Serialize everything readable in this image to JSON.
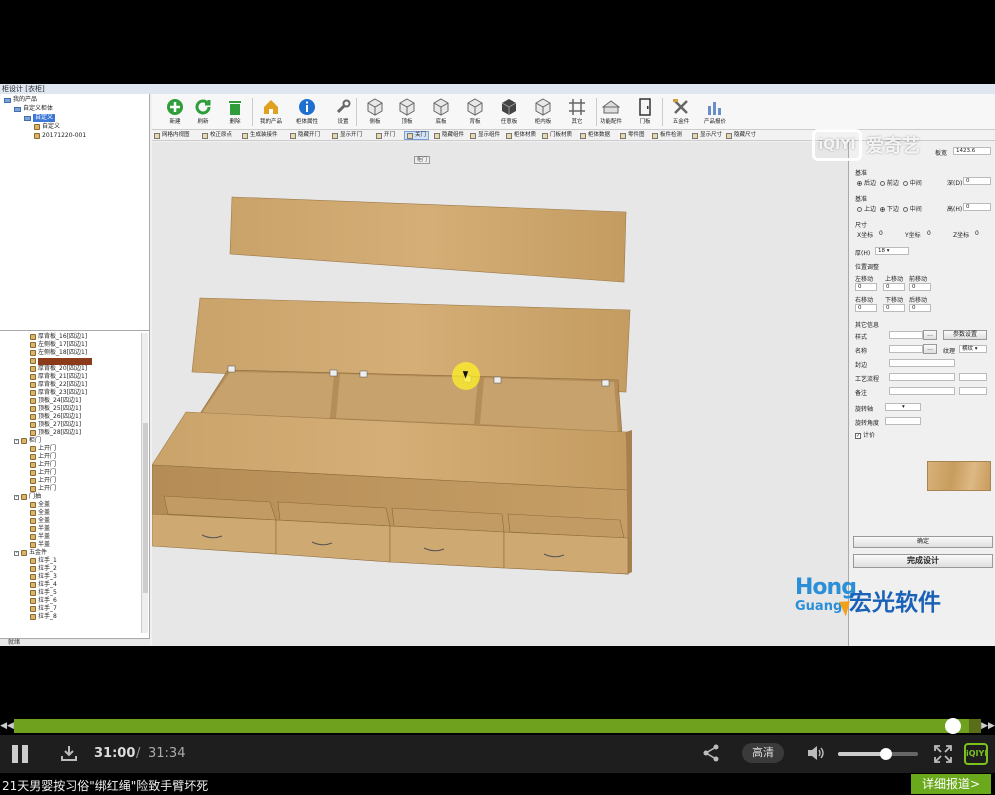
{
  "app": {
    "title": "柜设计 [衣柜]",
    "tree_top": [
      {
        "label": "我的产品",
        "level": 0,
        "kind": "folder"
      },
      {
        "label": "自定义柜体",
        "level": 1,
        "kind": "folder"
      },
      {
        "label": "自定义",
        "level": 2,
        "kind": "folder",
        "selected": true
      },
      {
        "label": "自定义",
        "level": 3,
        "kind": "item"
      },
      {
        "label": "20171220-001",
        "level": 3,
        "kind": "item"
      }
    ],
    "tree_bottom": [
      {
        "label": "厚背板_16[四边1]",
        "level": 3
      },
      {
        "label": "左侧板_17[四边1]",
        "level": 3
      },
      {
        "label": "左侧板_18[四边1]",
        "level": 3
      },
      {
        "label": "",
        "level": 3,
        "selected_red": true
      },
      {
        "label": "厚背板_20[四边1]",
        "level": 3
      },
      {
        "label": "厚背板_21[四边1]",
        "level": 3
      },
      {
        "label": "厚背板_22[四边1]",
        "level": 3
      },
      {
        "label": "厚背板_23[四边1]",
        "level": 3
      },
      {
        "label": "顶板_24[四边1]",
        "level": 3
      },
      {
        "label": "顶板_25[四边1]",
        "level": 3
      },
      {
        "label": "顶板_26[四边1]",
        "level": 3
      },
      {
        "label": "顶板_27[四边1]",
        "level": 3
      },
      {
        "label": "顶板_28[四边1]",
        "level": 3
      },
      {
        "label": "柜门",
        "level": 1,
        "group": true
      },
      {
        "label": "上开门",
        "level": 3
      },
      {
        "label": "上开门",
        "level": 3
      },
      {
        "label": "上开门",
        "level": 3
      },
      {
        "label": "上开门",
        "level": 3
      },
      {
        "label": "上开门",
        "level": 3
      },
      {
        "label": "上开门",
        "level": 3
      },
      {
        "label": "门抽",
        "level": 1,
        "group": true
      },
      {
        "label": "全盖",
        "level": 3
      },
      {
        "label": "全盖",
        "level": 3
      },
      {
        "label": "全盖",
        "level": 3
      },
      {
        "label": "半盖",
        "level": 3
      },
      {
        "label": "半盖",
        "level": 3
      },
      {
        "label": "半盖",
        "level": 3
      },
      {
        "label": "五金件",
        "level": 1,
        "group": true
      },
      {
        "label": "拉手_1",
        "level": 3
      },
      {
        "label": "拉手_2",
        "level": 3
      },
      {
        "label": "拉手_3",
        "level": 3
      },
      {
        "label": "拉手_4",
        "level": 3
      },
      {
        "label": "拉手_5",
        "level": 3
      },
      {
        "label": "拉手_6",
        "level": 3
      },
      {
        "label": "拉手_7",
        "level": 3
      },
      {
        "label": "拉手_8",
        "level": 3
      }
    ],
    "tree_footer": "就绪",
    "toolbar": [
      {
        "label": "新建",
        "icon": "plus-icon",
        "color": "#2e9d3a"
      },
      {
        "label": "刷新",
        "icon": "refresh-icon",
        "color": "#2e9d3a"
      },
      {
        "label": "删除",
        "icon": "trash-icon",
        "color": "#2e9d3a"
      },
      {
        "label": "我的产品",
        "icon": "home-icon",
        "color": "#e0a020"
      },
      {
        "label": "柜体属性",
        "icon": "info-icon",
        "color": "#1e6fd0"
      },
      {
        "label": "设置",
        "icon": "wrench-icon",
        "color": "#666666"
      },
      {
        "label": "侧板",
        "icon": "box-icon",
        "color": "#666666"
      },
      {
        "label": "顶板",
        "icon": "box-icon",
        "color": "#666666"
      },
      {
        "label": "底板",
        "icon": "box-icon",
        "color": "#666666"
      },
      {
        "label": "背板",
        "icon": "box-icon",
        "color": "#666666"
      },
      {
        "label": "任意板",
        "icon": "box-dark-icon",
        "color": "#444444"
      },
      {
        "label": "柜内板",
        "icon": "box-icon",
        "color": "#666666"
      },
      {
        "label": "其它",
        "icon": "grid-icon",
        "color": "#666666"
      },
      {
        "label": "功能配件",
        "icon": "appliance-icon",
        "color": "#666666"
      },
      {
        "label": "门板",
        "icon": "door-icon",
        "color": "#666666"
      },
      {
        "label": "五金件",
        "icon": "tools-icon",
        "color": "#666666"
      },
      {
        "label": "产品报价",
        "icon": "chart-icon",
        "color": "#666666"
      }
    ],
    "toolbar2": [
      {
        "label": "网格内视图",
        "active": false
      },
      {
        "label": "校正原点",
        "active": false
      },
      {
        "label": "生成装接件",
        "active": false
      },
      {
        "label": "隐藏开门",
        "active": false
      },
      {
        "label": "显示开门",
        "active": false
      },
      {
        "label": "开门",
        "active": false
      },
      {
        "label": "关门",
        "active": true
      },
      {
        "label": "隐藏组件",
        "active": false
      },
      {
        "label": "显示组件",
        "active": false
      },
      {
        "label": "柜体材质",
        "active": false
      },
      {
        "label": "门板材质",
        "active": false
      },
      {
        "label": "柜体数据",
        "active": false
      },
      {
        "label": "零件图",
        "active": false
      },
      {
        "label": "板件检测",
        "active": false
      },
      {
        "label": "显示尺寸",
        "active": false
      },
      {
        "label": "隐藏尺寸",
        "active": false
      }
    ],
    "viewport": {
      "door_tag": "柜门"
    },
    "props": {
      "board_label": "板宽",
      "board_value": "1423.6",
      "baseline1_label": "基准",
      "baseline1_options": [
        "后边",
        "前边",
        "中间"
      ],
      "baseline1_selected": 0,
      "depth_label": "深(D)",
      "depth_value": "0",
      "baseline2_label": "基准",
      "baseline2_options": [
        "上边",
        "下边",
        "中间"
      ],
      "baseline2_selected": 1,
      "height_label": "高(H)",
      "height_value": "0",
      "size_label": "尺寸",
      "x_label": "X坐标",
      "x_value": "0",
      "y_label": "Y坐标",
      "y_value": "0",
      "z_label": "Z坐标",
      "z_value": "0",
      "thickness_label": "厚(H)",
      "thickness_value": "18",
      "pos_label": "位置调整",
      "left_move": "左移动",
      "up_move": "上移动",
      "front_move": "前移动",
      "right_move": "右移动",
      "down_move": "下移动",
      "back_move": "后移动",
      "move_values": [
        "0",
        "0",
        "0",
        "0",
        "0",
        "0"
      ],
      "other_label": "其它信息",
      "style_label": "样式",
      "params_btn": "参数设置",
      "name_label": "名称",
      "grain_label": "纹理",
      "grain_value": "横纹",
      "edge_label": "封边",
      "process_label": "工艺流程",
      "note_label": "备注",
      "rotate_obj_label": "旋转轴",
      "rotate_angle_label": "旋转角度",
      "count_label": "计价",
      "confirm_btn": "确定",
      "finish_btn": "完成设计"
    }
  },
  "watermark": {
    "iqiyi_box": "iQIYI",
    "iqiyi_text": "爱奇艺",
    "hg_en1": "Hong",
    "hg_en2": "Guang",
    "hg_cn": "宏光软件"
  },
  "player": {
    "progress": 0.9873,
    "time_current": "31:00",
    "time_separator": "/",
    "time_total": "31:34",
    "quality": "高清",
    "volume": 0.6,
    "brand_icon": "iQIYI",
    "ticker_text": "21天男婴按习俗\"绑红绳\"险致手臂坏死",
    "ticker_button": "详细报道>",
    "accent_color": "#6fa11f"
  }
}
